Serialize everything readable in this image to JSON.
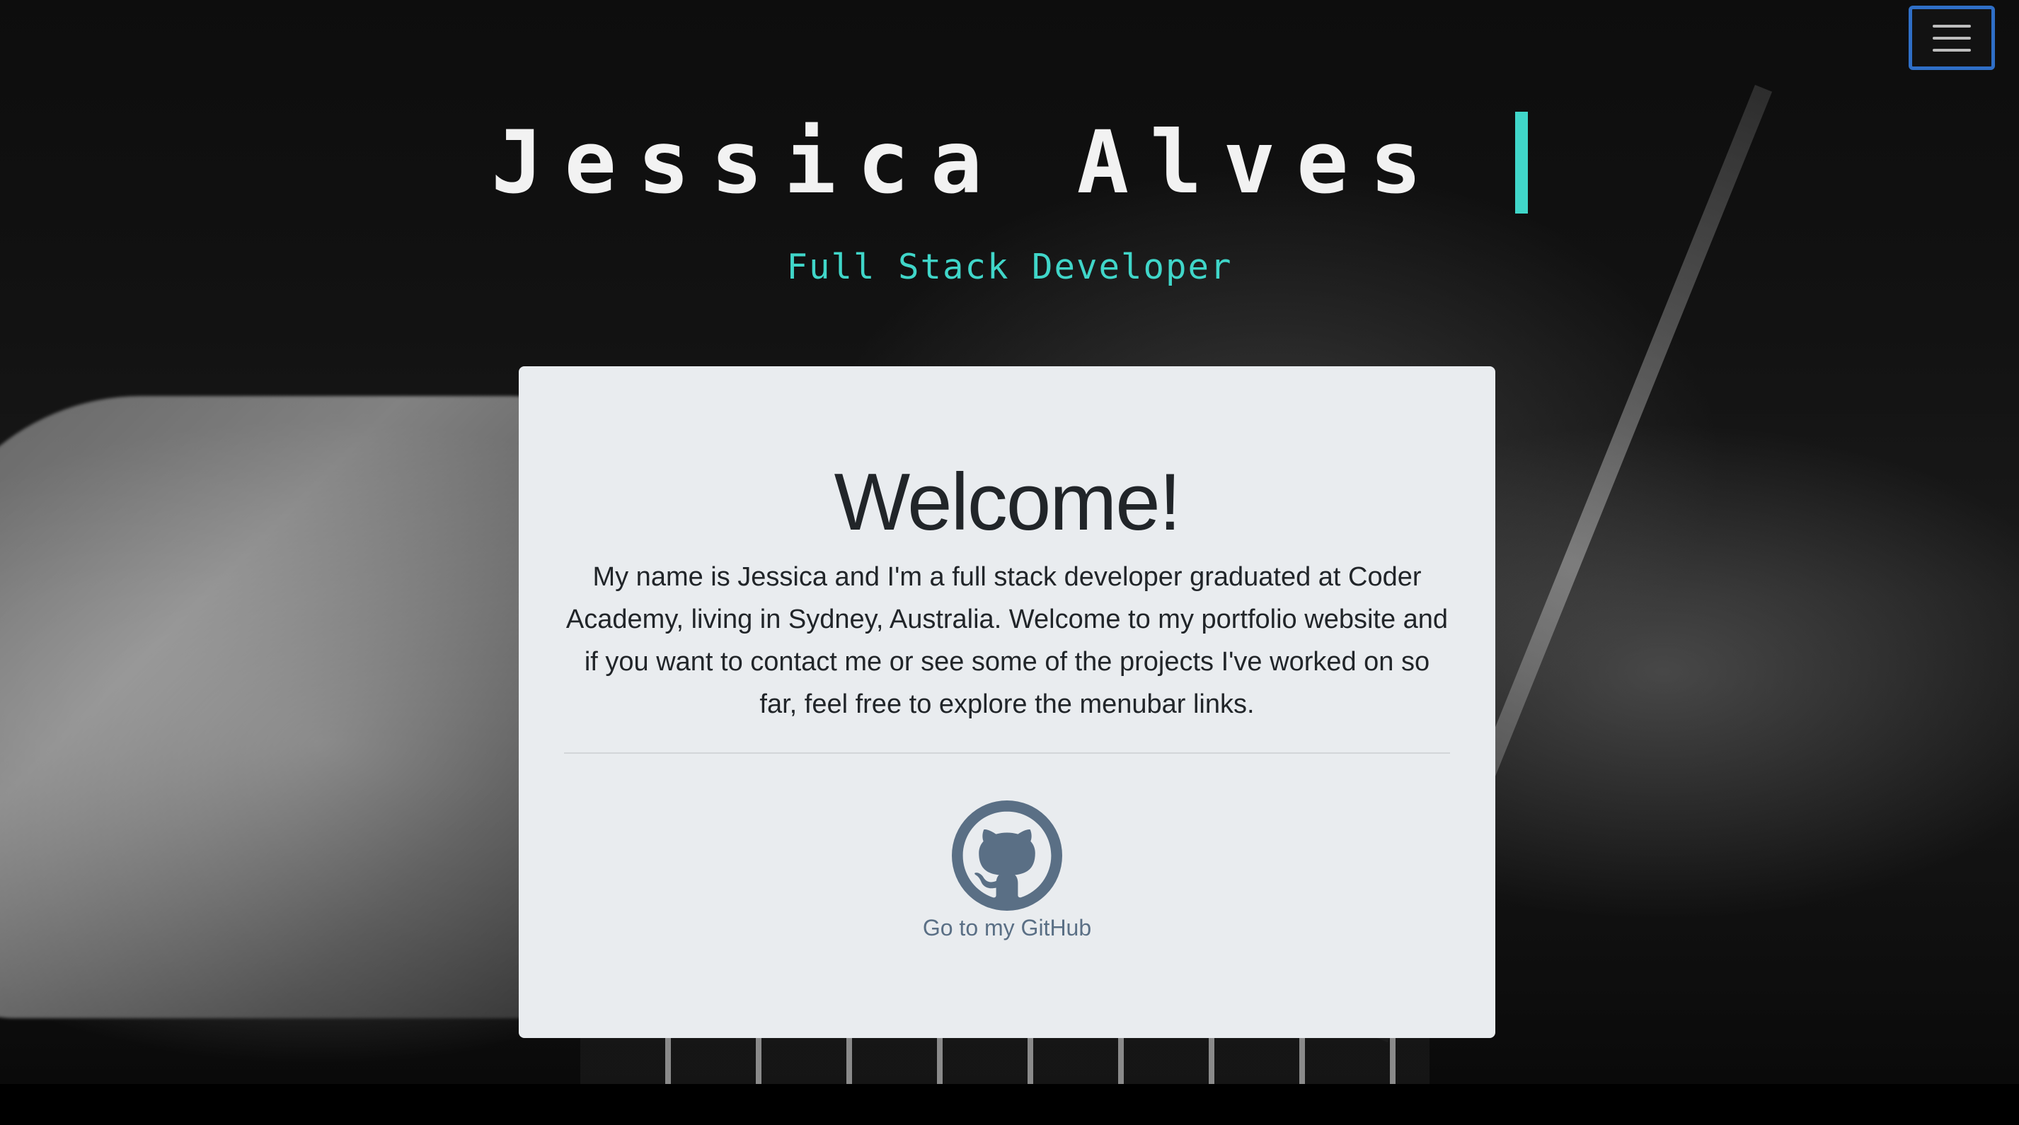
{
  "header": {
    "name": "Jessica Alves",
    "role": "Full Stack Developer",
    "menu_toggle_icon": "hamburger-icon"
  },
  "welcome": {
    "heading": "Welcome!",
    "intro": "My name is Jessica and I'm a full stack developer graduated at Coder Academy, living in Sydney, Australia. Welcome to my portfolio website and if you want to contact me or see some of the projects I've worked on so far, feel free to explore the menubar links.",
    "github_label": "Go to my GitHub",
    "github_icon": "github-icon"
  },
  "colors": {
    "accent": "#40d6c9",
    "card_bg": "#e9ecef",
    "link": "#5a6f85",
    "focus_ring": "#2f6fc7"
  }
}
